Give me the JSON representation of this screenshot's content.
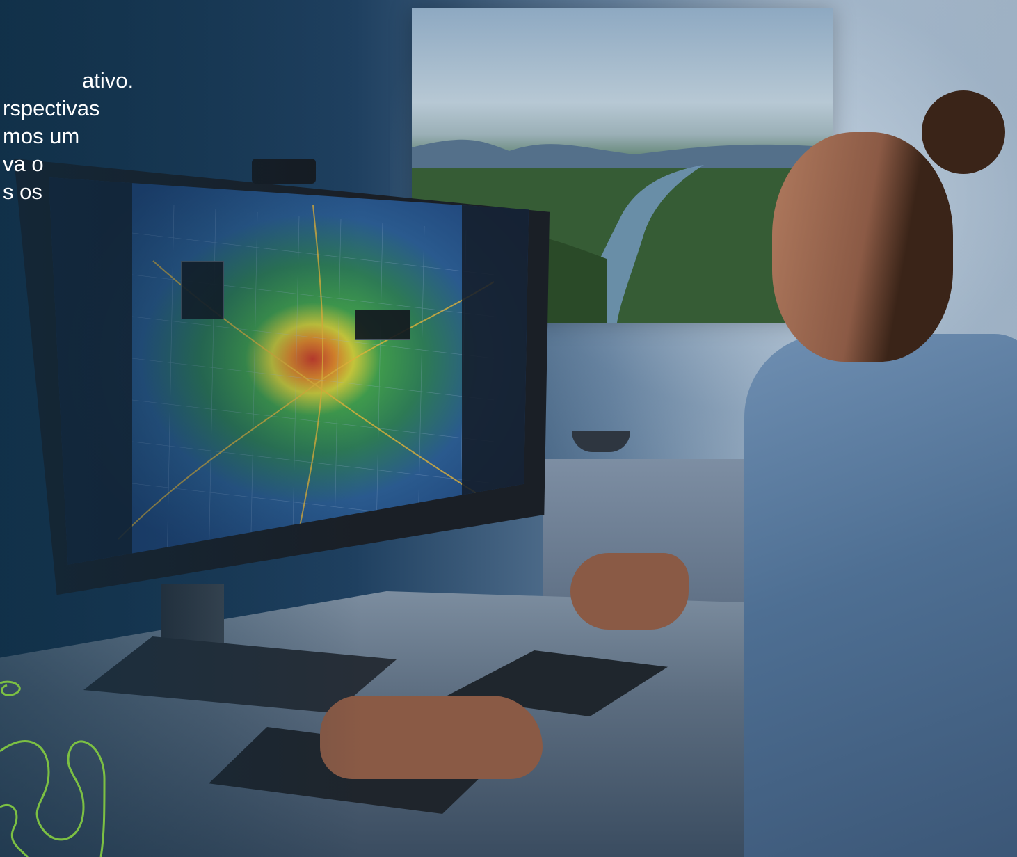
{
  "overlay_text": {
    "lines": [
      "ativo.",
      "rspectivas",
      "mos um",
      "va o",
      "s os"
    ]
  },
  "colors": {
    "caption": "#ffffff",
    "accent_line": "#7cc043",
    "overlay": "#0e2d44"
  }
}
